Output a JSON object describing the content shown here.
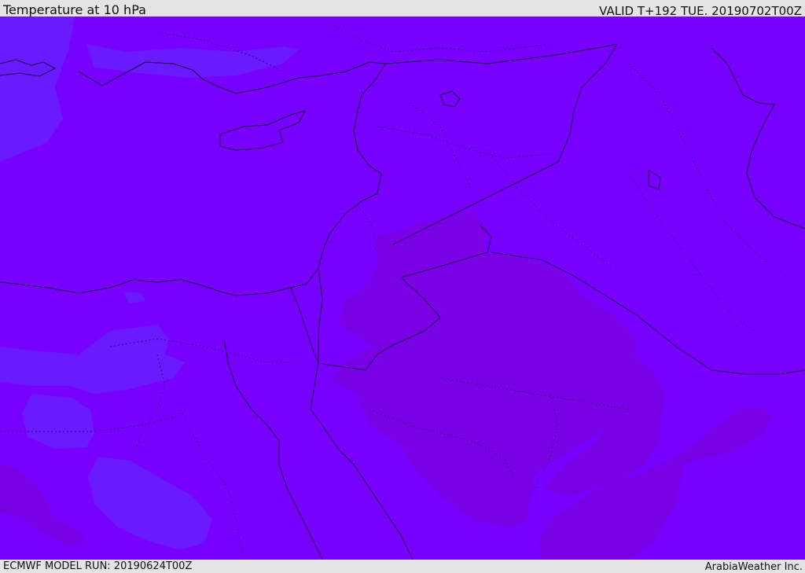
{
  "header": {
    "title": "Temperature at 10 hPa",
    "valid_time": "VALID T+192 TUE. 20190702T00Z"
  },
  "footer": {
    "model_run": "ECMWF MODEL RUN: 20190624T00Z",
    "credit": "ArabiaWeather Inc."
  },
  "map": {
    "colors": {
      "base_fill": "#7800ff",
      "cool_fill": "#6a1aff",
      "warm_fill": "#7a00e6",
      "coast_line": "#1a0040",
      "border_line": "#200050"
    }
  }
}
